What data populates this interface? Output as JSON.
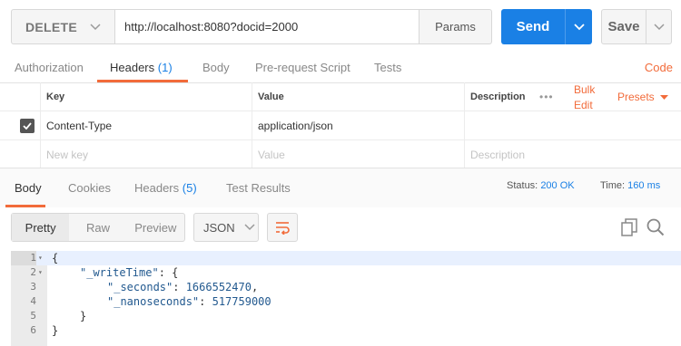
{
  "request": {
    "method": "DELETE",
    "url": "http://localhost:8080?docid=2000",
    "params_label": "Params",
    "send_label": "Send",
    "save_label": "Save"
  },
  "request_tabs": {
    "authorization": "Authorization",
    "headers": "Headers",
    "headers_count": "(1)",
    "body": "Body",
    "prerequest": "Pre-request Script",
    "tests": "Tests",
    "code": "Code"
  },
  "headers_table": {
    "col_key": "Key",
    "col_value": "Value",
    "col_description": "Description",
    "bulk_edit_line1": "Bulk",
    "bulk_edit_line2": "Edit",
    "presets": "Presets",
    "rows": [
      {
        "key": "Content-Type",
        "value": "application/json",
        "checked": true
      }
    ],
    "placeholder_key": "New key",
    "placeholder_value": "Value",
    "placeholder_description": "Description"
  },
  "response_tabs": {
    "body": "Body",
    "cookies": "Cookies",
    "headers": "Headers",
    "headers_count": "(5)",
    "test_results": "Test Results"
  },
  "response_meta": {
    "status_label": "Status:",
    "status_value": "200 OK",
    "time_label": "Time:",
    "time_value": "160 ms"
  },
  "view_modes": {
    "pretty": "Pretty",
    "raw": "Raw",
    "preview": "Preview",
    "format": "JSON"
  },
  "response_body": {
    "line_numbers": [
      "1",
      "2",
      "3",
      "4",
      "5",
      "6"
    ],
    "open_brace": "{",
    "write_time_key": "\"_writeTime\"",
    "colon_brace": ": {",
    "seconds_key": "\"_seconds\"",
    "seconds_value": "1666552470",
    "nanoseconds_key": "\"_nanoseconds\"",
    "nanoseconds_value": "517759000",
    "inner_close": "}",
    "outer_close": "}"
  },
  "colors": {
    "accent_orange": "#f26b3a",
    "send_blue": "#1a80e5"
  }
}
